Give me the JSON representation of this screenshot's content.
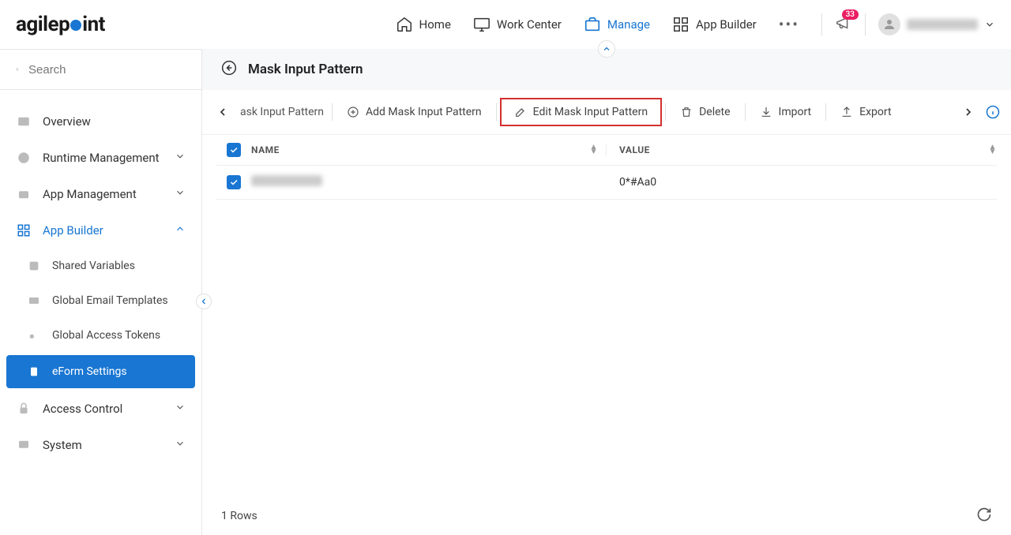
{
  "brand": {
    "part1": "agilep",
    "part2": "int"
  },
  "nav": {
    "home": "Home",
    "work_center": "Work Center",
    "manage": "Manage",
    "app_builder": "App Builder"
  },
  "notifications": {
    "count": "33"
  },
  "search": {
    "placeholder": "Search"
  },
  "sidebar": {
    "overview": "Overview",
    "runtime": "Runtime Management",
    "app_mgmt": "App Management",
    "app_builder": "App Builder",
    "shared_vars": "Shared Variables",
    "email_tpl": "Global Email Templates",
    "access_tokens": "Global Access Tokens",
    "eform": "eForm Settings",
    "access_ctrl": "Access Control",
    "system": "System"
  },
  "page": {
    "title": "Mask Input Pattern"
  },
  "toolbar": {
    "breadcrumb_suffix": "ask Input Pattern",
    "add": "Add Mask Input Pattern",
    "edit": "Edit Mask Input Pattern",
    "delete": "Delete",
    "import": "Import",
    "export": "Export"
  },
  "table": {
    "cols": {
      "name": "NAME",
      "value": "VALUE"
    },
    "rows": [
      {
        "name_hidden": true,
        "value": "0*#Aa0"
      }
    ],
    "footer": "1 Rows"
  }
}
